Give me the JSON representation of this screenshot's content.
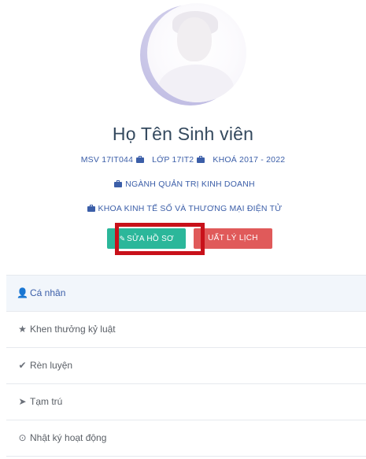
{
  "profile": {
    "name": "Họ Tên Sinh viên",
    "student_id": "MSV 17IT044",
    "class": "LỚP 17IT2",
    "cohort": "KHOÁ 2017 - 2022",
    "major": "NGÀNH QUẢN TRỊ KINH DOANH",
    "faculty": "KHOA KINH TẾ SỐ VÀ THƯƠNG MẠI ĐIỆN TỬ"
  },
  "actions": {
    "edit_label": "SỬA HỒ SƠ",
    "export_label": "UẤT LÝ LỊCH"
  },
  "menu": {
    "items": [
      {
        "label": "Cá nhân",
        "icon": "user-icon"
      },
      {
        "label": "Khen thưởng kỷ luật",
        "icon": "star-icon"
      },
      {
        "label": "Rèn luyện",
        "icon": "check-icon"
      },
      {
        "label": "Tạm trú",
        "icon": "location-arrow-icon"
      },
      {
        "label": "Nhật ký hoạt động",
        "icon": "clock-icon"
      }
    ]
  },
  "colors": {
    "accent": "#3b5ea8",
    "edit_button": "#2bb79a",
    "export_button": "#e05a5a",
    "highlight": "#c8111a"
  }
}
